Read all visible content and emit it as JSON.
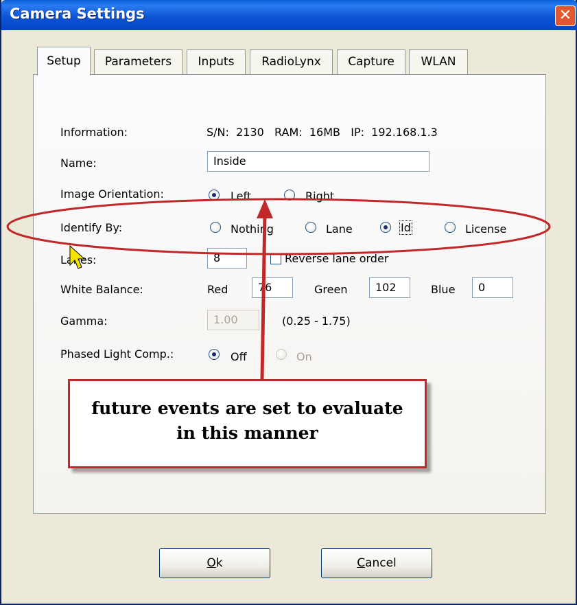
{
  "window": {
    "title": "Camera Settings",
    "close_glyph": "✕"
  },
  "tabs": [
    {
      "label": "Setup",
      "active": true
    },
    {
      "label": "Parameters"
    },
    {
      "label": "Inputs"
    },
    {
      "label": "RadioLynx"
    },
    {
      "label": "Capture"
    },
    {
      "label": "WLAN"
    }
  ],
  "setup": {
    "information_label": "Information:",
    "information_value": "S/N:  2130   RAM:  16MB   IP:  192.168.1.3",
    "name_label": "Name:",
    "name_value": "Inside",
    "orientation_label": "Image Orientation:",
    "orientation_options": [
      "Left",
      "Right"
    ],
    "orientation_selected": "Left",
    "identify_label": "Identify By:",
    "identify_options": [
      "Nothing",
      "Lane",
      "Id",
      "License"
    ],
    "identify_selected": "Id",
    "lanes_label": "Lanes:",
    "lanes_value": "8",
    "reverse_lane_label": "Reverse lane order",
    "reverse_lane_checked": false,
    "wb_label": "White Balance:",
    "wb_red_label": "Red",
    "wb_red_value": "76",
    "wb_green_label": "Green",
    "wb_green_value": "102",
    "wb_blue_label": "Blue",
    "wb_blue_value": "0",
    "gamma_label": "Gamma:",
    "gamma_value": "1.00",
    "gamma_range": "(0.25 - 1.75)",
    "phased_label": "Phased Light Comp.:",
    "phased_options": [
      "Off",
      "On"
    ],
    "phased_selected": "Off"
  },
  "annotation": {
    "callout_line1": "future events are set to evaluate",
    "callout_line2": "in this manner",
    "color": "#c0282a"
  },
  "buttons": {
    "ok_mnemonic": "O",
    "ok_rest": "k",
    "cancel_mnemonic": "C",
    "cancel_rest": "ancel"
  },
  "colors": {
    "titlebar": "#0a5fd8",
    "dialog": "#ece9d8",
    "annotation_red": "#c0282a"
  }
}
